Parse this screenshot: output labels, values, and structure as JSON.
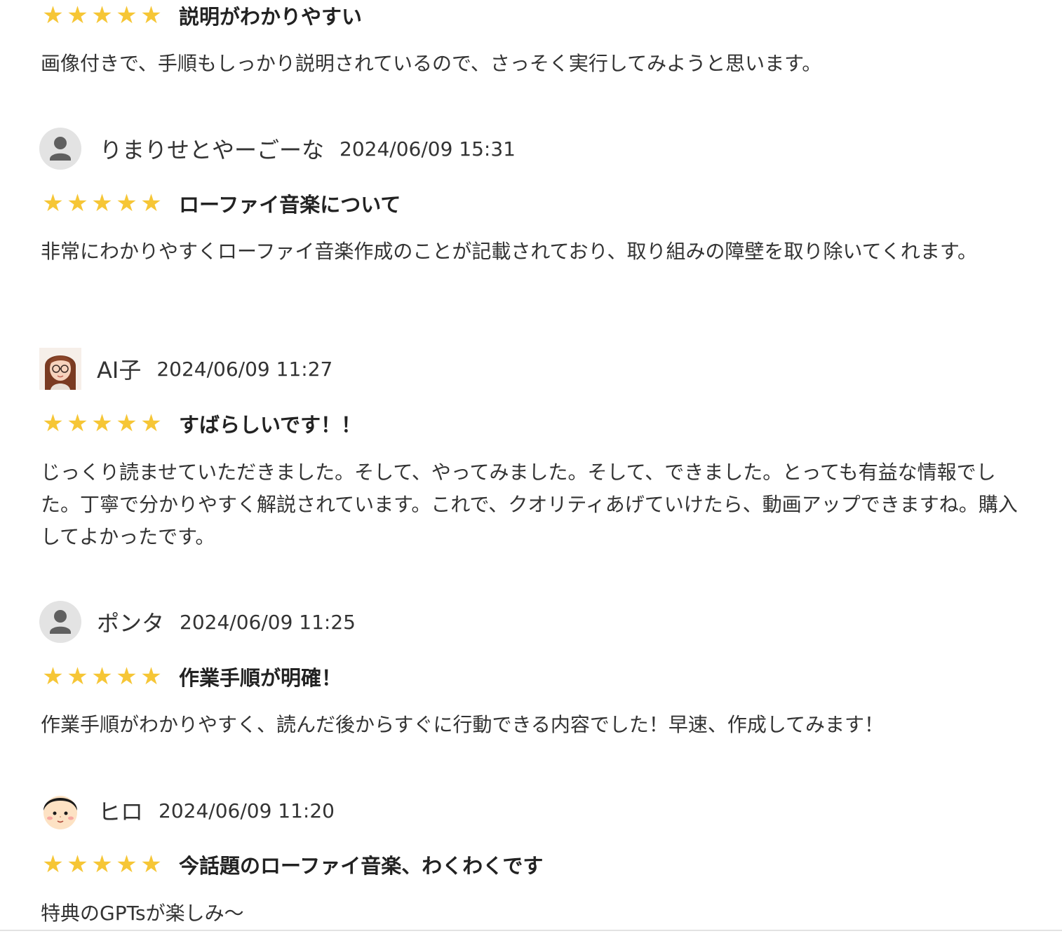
{
  "reviews": [
    {
      "title": "説明がわかりやすい",
      "body": "画像付きで、手順もしっかり説明されているので、さっそく実行してみようと思います。"
    },
    {
      "user": "りまりせとやーごーな",
      "date": "2024/06/09 15:31",
      "avatar": "default-avatar",
      "title": "ローファイ音楽について",
      "body": "非常にわかりやすくローファイ音楽作成のことが記載されており、取り組みの障壁を取り除いてくれます。"
    },
    {
      "user": "AI子",
      "date": "2024/06/09 11:27",
      "avatar": "anime-girl-glasses-avatar",
      "title": "すばらしいです！！",
      "body": "じっくり読ませていただきました。そして、やってみました。そして、できました。とっても有益な情報でした。丁寧で分かりやすく解説されています。これで、クオリティあげていけたら、動画アップできますね。購入してよかったです。"
    },
    {
      "user": "ポンタ",
      "date": "2024/06/09 11:25",
      "avatar": "default-avatar",
      "title": "作業手順が明確！",
      "body": "作業手順がわかりやすく、読んだ後からすぐに行動できる内容でした！早速、作成してみます！"
    },
    {
      "user": "ヒロ",
      "date": "2024/06/09 11:20",
      "avatar": "boy-face-avatar",
      "title": "今話題のローファイ音楽、わくわくです",
      "body": "特典のGPTsが楽しみ〜"
    }
  ],
  "star_glyph": "★",
  "star_color": "#f6c636",
  "rating_stars": 5
}
